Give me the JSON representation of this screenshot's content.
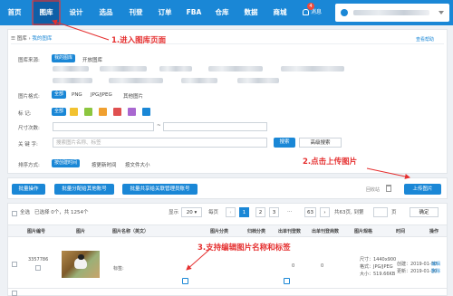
{
  "nav": {
    "items": [
      "首页",
      "图库",
      "设计",
      "选品",
      "刊登",
      "订单",
      "FBA",
      "仓库",
      "数据",
      "商城"
    ],
    "active": "图库",
    "message_label": "消息",
    "message_count": "4"
  },
  "breadcrumb": {
    "root": "图库",
    "sep": "›",
    "current": "我的图库"
  },
  "help_link": "查看帮助",
  "filters": {
    "source_label": "图库来源:",
    "source_active": "我的图库",
    "source_other": "开放图库",
    "format_label": "图片格式:",
    "format_options": [
      "全部",
      "PNG",
      "JPG/JPEG",
      "其他图片"
    ],
    "mark_label": "标    记:",
    "mark_all": "全部",
    "size_label": "尺寸次数:",
    "range_sep": "~",
    "keyword_label": "关 键 字:",
    "search_placeholder": "搜索图片名称、标签",
    "search_button": "搜索",
    "advanced_button": "高级搜索",
    "sort_label": "排序方式:",
    "sort_active": "按创建时间",
    "sort_options": [
      "按更新时间",
      "按文件大小"
    ]
  },
  "mark_colors": [
    "#f2c230",
    "#8cc63f",
    "#f0a030",
    "#e05050",
    "#a968d0",
    "#1a87d6"
  ],
  "toolbar": {
    "batch_ops": "批量操作",
    "batch_assign": "批量分配给其他账号",
    "batch_share": "批量共享给关联管理员账号",
    "recycle": "回收站",
    "upload": "上传图片"
  },
  "pagination": {
    "select_all": "全选",
    "selected": "已选择 0个，共 1254个",
    "show_label": "显示",
    "per_page": "20",
    "per_page_suffix": "每页",
    "pages": [
      "1",
      "2",
      "3",
      "...",
      "63"
    ],
    "prev": "‹",
    "next": "›",
    "total_pages": "共63页, 到第",
    "page_suffix": "页",
    "confirm": "确定"
  },
  "table": {
    "headers": [
      "图片编号",
      "图片",
      "图片名称（英文）",
      "图片分类",
      "归档分类",
      "出单刊登数",
      "出单刊登商数",
      "图片规格",
      "时间",
      "操作"
    ],
    "rows": [
      {
        "id": "3357786",
        "tag_label": "标签:",
        "count1": "0",
        "count2": "0",
        "spec": [
          "尺寸：1440x900",
          "格式：JPG/JPEG",
          "大小：519.66KB"
        ],
        "time": [
          "创建：2019-01-30",
          "更新：2019-01-30"
        ],
        "ops": [
          "编辑",
          "删除"
        ]
      }
    ]
  },
  "annotations": {
    "a1": "1.进入图库页面",
    "a2": "2.点击上传图片",
    "a3": "3.支持编辑图片名称和标签"
  }
}
